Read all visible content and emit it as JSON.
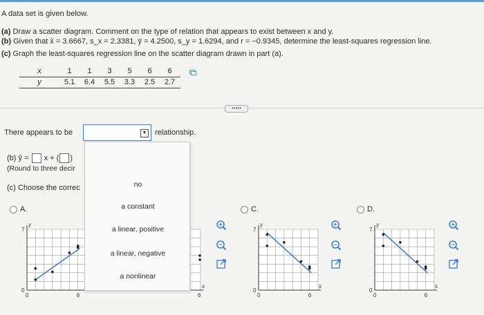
{
  "intro": "A data set is given below.",
  "parts": {
    "a_label": "(a)",
    "a_text": "Draw a scatter diagram. Comment on the type of relation that appears to exist between x and y.",
    "b_label": "(b)",
    "b_text": "Given that x̄ = 3.6667, s_x = 2.3381, ȳ = 4.2500, s_y = 1.6294, and r = −0.9345, determine the least-squares regression line.",
    "c_label": "(c)",
    "c_text": "Graph the least-squares regression line on the scatter diagram drawn in part (a)."
  },
  "data_table": {
    "x_label": "x",
    "y_label": "y",
    "x_values": [
      "1",
      "1",
      "3",
      "5",
      "6",
      "6"
    ],
    "y_values": [
      "5.1",
      "6.4",
      "5.5",
      "3.3",
      "2.5",
      "2.7"
    ]
  },
  "more_button": "•••••",
  "question": {
    "prefix": "There appears to be",
    "suffix": "relationship."
  },
  "dropdown": {
    "options": [
      "no",
      "a constant",
      "a linear, positive",
      "a linear, negative",
      "a nonlinear"
    ]
  },
  "part_b": {
    "label": "(b)",
    "yhat": "ŷ =",
    "xplus": "x +",
    "round_note": "(Round to three decir"
  },
  "part_c": {
    "label": "(c)",
    "text": "Choose the correc"
  },
  "choices": [
    {
      "letter": "A.",
      "axis_y": "y",
      "axis_x": "x",
      "tick_7": "7",
      "tick_0": "0",
      "tick_6": "6"
    },
    {
      "letter": "C.",
      "axis_y": "y",
      "axis_x": "x",
      "tick_7": "7",
      "tick_0": "0",
      "tick_6": "6"
    },
    {
      "letter": "D.",
      "axis_y": "y",
      "axis_x": "x",
      "tick_7": "7",
      "tick_0": "0",
      "tick_6": "6"
    }
  ],
  "colors": {
    "accent": "#3b7dd8",
    "line": "#2f6fc9",
    "point": "#222222"
  }
}
